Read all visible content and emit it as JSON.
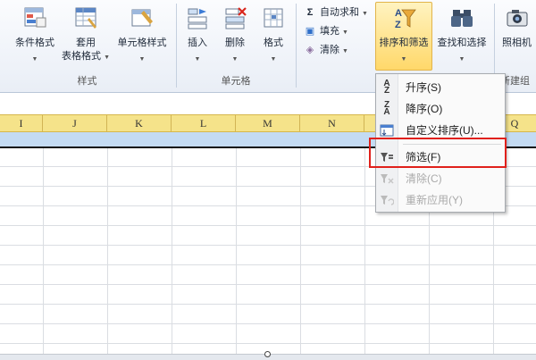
{
  "ribbon": {
    "styles_group": {
      "label": "样式",
      "conditional_format": "条件格式",
      "table_format_line1": "套用",
      "table_format_line2": "表格格式",
      "cell_style": "单元格样式"
    },
    "cells_group": {
      "label": "单元格",
      "insert": "插入",
      "delete": "删除",
      "format": "格式"
    },
    "editing_group": {
      "autosum": "自动求和",
      "fill": "填充",
      "clear": "清除",
      "sort_filter": "排序和筛选",
      "find_select": "查找和选择"
    },
    "new_group": {
      "camera": "照相机",
      "label": "新建组"
    }
  },
  "columns": [
    "I",
    "J",
    "K",
    "L",
    "M",
    "N",
    "Q"
  ],
  "menu": {
    "items": [
      {
        "label": "升序(S)",
        "icon": "sort-ascending-icon",
        "enabled": true
      },
      {
        "label": "降序(O)",
        "icon": "sort-descending-icon",
        "enabled": true
      },
      {
        "label": "自定义排序(U)...",
        "icon": "custom-sort-icon",
        "enabled": true
      },
      {
        "label": "筛选(F)",
        "icon": "filter-icon",
        "enabled": true
      },
      {
        "label": "清除(C)",
        "icon": "clear-filter-icon",
        "enabled": false
      },
      {
        "label": "重新应用(Y)",
        "icon": "reapply-filter-icon",
        "enabled": false
      }
    ]
  },
  "colors": {
    "header_yellow": "#f5e38a",
    "selection_blue": "#c4dbf3",
    "highlight_red": "#e0201b"
  }
}
